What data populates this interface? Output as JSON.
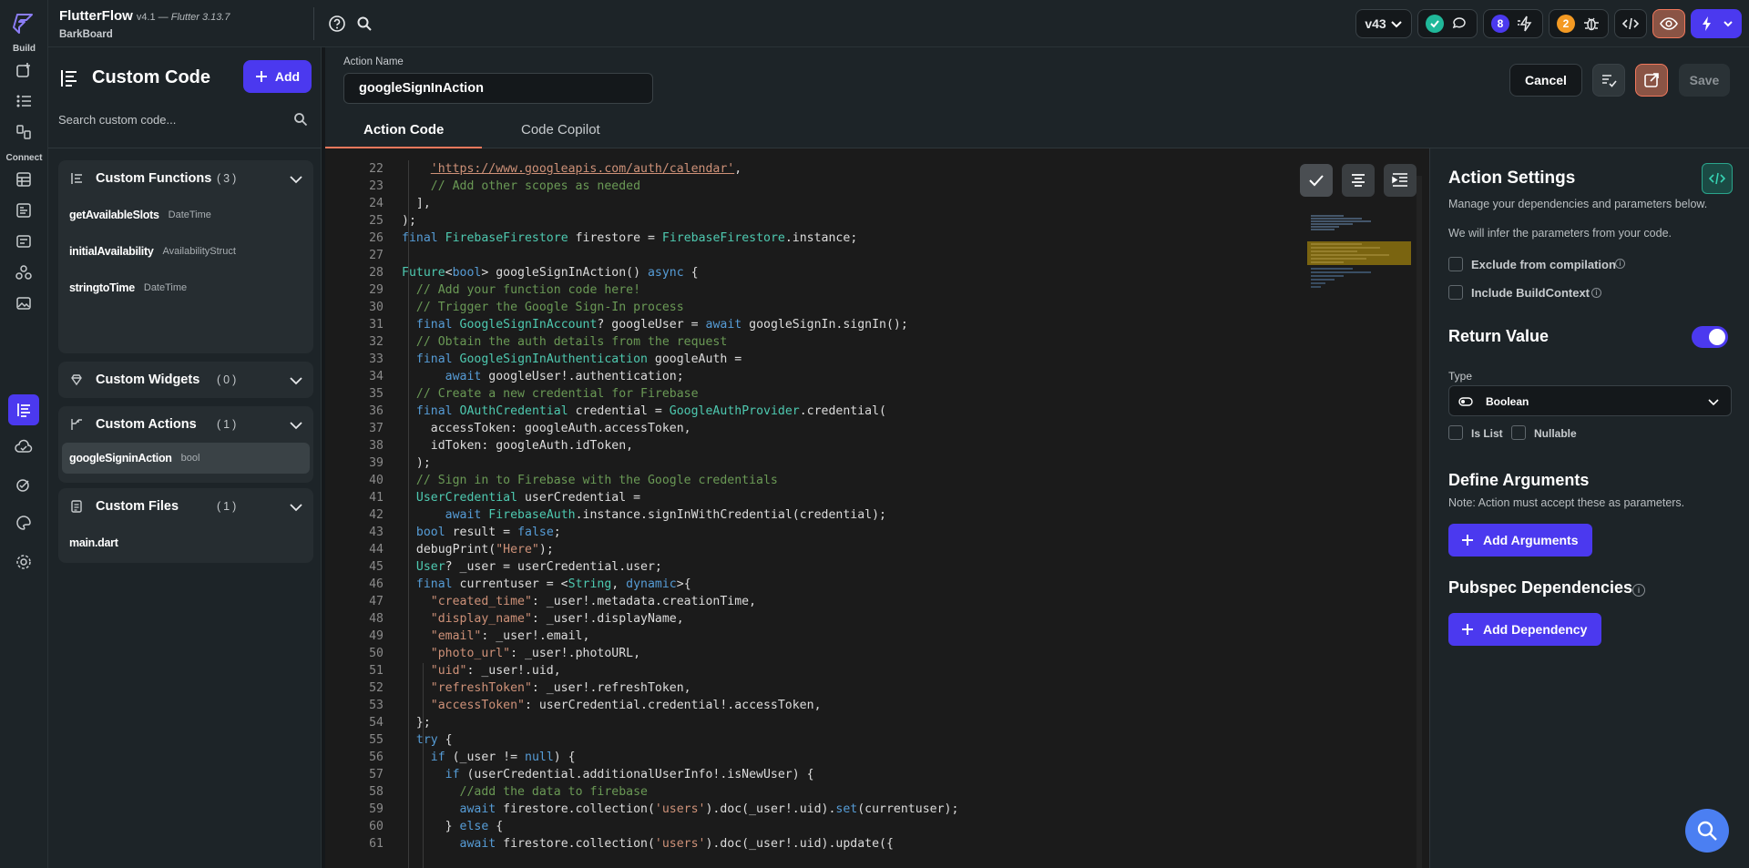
{
  "app": {
    "name": "FlutterFlow",
    "version": "v4.1 — ",
    "flutter": "Flutter 3.13.7",
    "project": "BarkBoard"
  },
  "rail": {
    "build_label": "Build",
    "connect_label": "Connect"
  },
  "topbar": {
    "version_selector": "v43",
    "notif_purple": "8",
    "notif_orange": "2"
  },
  "left_panel": {
    "title": "Custom Code",
    "add_label": "Add",
    "search_placeholder": "Search custom code...",
    "groups": [
      {
        "label": "Custom Functions",
        "count": "(3)",
        "items": [
          {
            "name": "getAvailableSlots",
            "type": "DateTime"
          },
          {
            "name": "initialAvailability",
            "type": "AvailabilityStruct"
          },
          {
            "name": "stringtoTime",
            "type": "DateTime"
          }
        ]
      },
      {
        "label": "Custom Widgets",
        "count": "(0)",
        "items": []
      },
      {
        "label": "Custom Actions",
        "count": "(1)",
        "items": [
          {
            "name": "googleSigninAction",
            "type": "bool"
          }
        ]
      },
      {
        "label": "Custom Files",
        "count": "(1)",
        "items": [
          {
            "name": "main.dart",
            "type": ""
          }
        ]
      }
    ]
  },
  "editor_header": {
    "action_name_label": "Action Name",
    "action_name_value": "googleSignInAction",
    "cancel_label": "Cancel",
    "save_label": "Save",
    "tabs": [
      "Action Code",
      "Code Copilot"
    ]
  },
  "code_lines": [
    {
      "n": "22",
      "html": "    <span class=\"u\">'https://www.googleapis.com/auth/calendar'</span><span class=\"p\">,</span>"
    },
    {
      "n": "23",
      "html": "    <span class=\"c\">// Add other scopes as needed</span>"
    },
    {
      "n": "24",
      "html": "  <span class=\"p\">],</span>"
    },
    {
      "n": "25",
      "html": "<span class=\"p\">);</span>"
    },
    {
      "n": "26",
      "html": "<span class=\"k\">final</span> <span class=\"t\">FirebaseFirestore</span> <span class=\"p\">firestore = </span><span class=\"t\">FirebaseFirestore</span><span class=\"p\">.instance;</span>"
    },
    {
      "n": "27",
      "html": ""
    },
    {
      "n": "28",
      "html": "<span class=\"t\">Future</span><span class=\"p\">&lt;</span><span class=\"k\">bool</span><span class=\"p\">&gt; googleSignInAction() </span><span class=\"k\">async</span><span class=\"p\"> {</span>"
    },
    {
      "n": "29",
      "html": "  <span class=\"c\">// Add your function code here!</span>"
    },
    {
      "n": "30",
      "html": "  <span class=\"c\">// Trigger the Google Sign-In process</span>"
    },
    {
      "n": "31",
      "html": "  <span class=\"k\">final</span> <span class=\"t\">GoogleSignInAccount</span><span class=\"p\">? googleUser = </span><span class=\"k\">await</span><span class=\"p\"> googleSignIn.signIn();</span>"
    },
    {
      "n": "32",
      "html": "  <span class=\"c\">// Obtain the auth details from the request</span>"
    },
    {
      "n": "33",
      "html": "  <span class=\"k\">final</span> <span class=\"t\">GoogleSignInAuthentication</span><span class=\"p\"> googleAuth =</span>"
    },
    {
      "n": "34",
      "html": "      <span class=\"k\">await</span><span class=\"p\"> googleUser!.authentication;</span>"
    },
    {
      "n": "35",
      "html": "  <span class=\"c\">// Create a new credential for Firebase</span>"
    },
    {
      "n": "36",
      "html": "  <span class=\"k\">final</span> <span class=\"t\">OAuthCredential</span><span class=\"p\"> credential = </span><span class=\"t\">GoogleAuthProvider</span><span class=\"p\">.credential(</span>"
    },
    {
      "n": "37",
      "html": "    <span class=\"p\">accessToken: googleAuth.accessToken,</span>"
    },
    {
      "n": "38",
      "html": "    <span class=\"p\">idToken: googleAuth.idToken,</span>"
    },
    {
      "n": "39",
      "html": "  <span class=\"p\">);</span>"
    },
    {
      "n": "40",
      "html": "  <span class=\"c\">// Sign in to Firebase with the Google credentials</span>"
    },
    {
      "n": "41",
      "html": "  <span class=\"t\">UserCredential</span><span class=\"p\"> userCredential =</span>"
    },
    {
      "n": "42",
      "html": "      <span class=\"k\">await</span> <span class=\"t\">FirebaseAuth</span><span class=\"p\">.instance.signInWithCredential(credential);</span>"
    },
    {
      "n": "43",
      "html": "  <span class=\"k\">bool</span><span class=\"p\"> result = </span><span class=\"k\">false</span><span class=\"p\">;</span>"
    },
    {
      "n": "44",
      "html": "  <span class=\"p\">debugPrint(</span><span class=\"s\">\"Here\"</span><span class=\"p\">);</span>"
    },
    {
      "n": "45",
      "html": "  <span class=\"t\">User</span><span class=\"p\">? _user = userCredential.user;</span>"
    },
    {
      "n": "46",
      "html": "  <span class=\"k\">final</span><span class=\"p\"> currentuser = &lt;</span><span class=\"t\">String</span><span class=\"p\">, </span><span class=\"k\">dynamic</span><span class=\"p\">&gt;{</span>"
    },
    {
      "n": "47",
      "html": "    <span class=\"s\">\"created_time\"</span><span class=\"p\">: _user!.metadata.creationTime,</span>"
    },
    {
      "n": "48",
      "html": "    <span class=\"s\">\"display_name\"</span><span class=\"p\">: _user!.displayName,</span>"
    },
    {
      "n": "49",
      "html": "    <span class=\"s\">\"email\"</span><span class=\"p\">: _user!.email,</span>"
    },
    {
      "n": "50",
      "html": "    <span class=\"s\">\"photo_url\"</span><span class=\"p\">: _user!.photoURL,</span>"
    },
    {
      "n": "51",
      "html": "    <span class=\"s\">\"uid\"</span><span class=\"p\">: _user!.uid,</span>"
    },
    {
      "n": "52",
      "html": "    <span class=\"s\">\"refreshToken\"</span><span class=\"p\">: _user!.refreshToken,</span>"
    },
    {
      "n": "53",
      "html": "    <span class=\"s\">\"accessToken\"</span><span class=\"p\">: userCredential.credential!.accessToken,</span>"
    },
    {
      "n": "54",
      "html": "  <span class=\"p\">};</span>"
    },
    {
      "n": "55",
      "html": "  <span class=\"k\">try</span><span class=\"p\"> {</span>"
    },
    {
      "n": "56",
      "html": "    <span class=\"k\">if</span><span class=\"p\"> (_user != </span><span class=\"k\">null</span><span class=\"p\">) {</span>"
    },
    {
      "n": "57",
      "html": "      <span class=\"k\">if</span><span class=\"p\"> (userCredential.additionalUserInfo!.isNewUser) {</span>"
    },
    {
      "n": "58",
      "html": "        <span class=\"c\">//add the data to firebase</span>"
    },
    {
      "n": "59",
      "html": "        <span class=\"k\">await</span><span class=\"p\"> firestore.collection(</span><span class=\"s\">'users'</span><span class=\"p\">).doc(_user!.uid).</span><span class=\"k\">set</span><span class=\"p\">(currentuser);</span>"
    },
    {
      "n": "60",
      "html": "      <span class=\"p\">} </span><span class=\"k\">else</span><span class=\"p\"> {</span>"
    },
    {
      "n": "61",
      "html": "        <span class=\"k\">await</span><span class=\"p\"> firestore.collection(</span><span class=\"s\">'users'</span><span class=\"p\">).doc(_user!.uid).update({</span>"
    }
  ],
  "settings": {
    "title": "Action Settings",
    "desc1": "Manage your dependencies and parameters below.",
    "desc2": "We will infer the parameters from your code.",
    "exclude_label": "Exclude from compilation",
    "include_ctx_label": "Include BuildContext",
    "return_title": "Return Value",
    "type_label": "Type",
    "type_value": "Boolean",
    "is_list_label": "Is List",
    "nullable_label": "Nullable",
    "args_title": "Define Arguments",
    "args_note": "Note: Action must accept these as parameters.",
    "add_args_label": "Add Arguments",
    "pubspec_title": "Pubspec Dependencies",
    "add_dep_label": "Add Dependency"
  },
  "colors": {
    "accent": "#4b39ef",
    "orange": "#f2785c",
    "bg": "#1d2428"
  }
}
